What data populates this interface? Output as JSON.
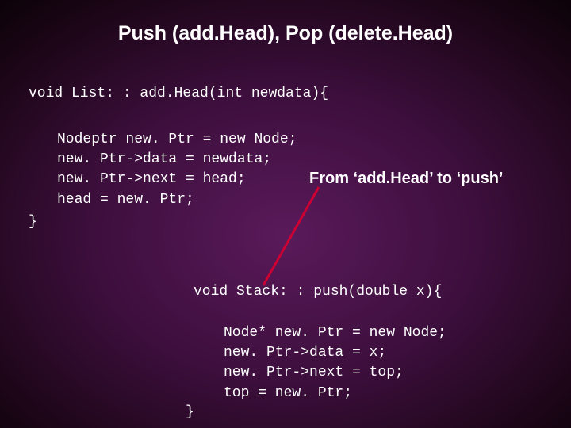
{
  "title": "Push (add.Head), Pop (delete.Head)",
  "code1": {
    "signature": "void List: : add.Head(int newdata){",
    "body": "Nodeptr new. Ptr = new Node;\nnew. Ptr->data = newdata;\nnew. Ptr->next = head;\nhead = new. Ptr;",
    "close": "}"
  },
  "annotation": "From ‘add.Head’ to ‘push’",
  "code2": {
    "signature": "void Stack: : push(double x){",
    "body": "Node* new. Ptr = new Node;\nnew. Ptr->data = x;\nnew. Ptr->next = top;\ntop = new. Ptr;",
    "close": "}"
  }
}
